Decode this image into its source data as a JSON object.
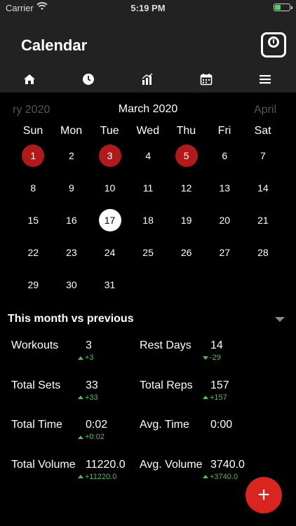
{
  "status_bar": {
    "carrier": "Carrier",
    "time": "5:19 PM",
    "battery_color": "#4cd964"
  },
  "header": {
    "title": "Calendar",
    "action_icon": "scale-icon"
  },
  "tabs": [
    {
      "icon": "home-icon"
    },
    {
      "icon": "clock-icon"
    },
    {
      "icon": "chart-icon"
    },
    {
      "icon": "calendar-icon"
    },
    {
      "icon": "menu-icon"
    }
  ],
  "calendar": {
    "prev_month": "ry 2020",
    "current_month": "March 2020",
    "next_month": "April",
    "weekdays": [
      "Sun",
      "Mon",
      "Tue",
      "Wed",
      "Thu",
      "Fri",
      "Sat"
    ],
    "days": [
      "1",
      "2",
      "3",
      "4",
      "5",
      "6",
      "7",
      "8",
      "9",
      "10",
      "11",
      "12",
      "13",
      "14",
      "15",
      "16",
      "17",
      "18",
      "19",
      "20",
      "21",
      "22",
      "23",
      "24",
      "25",
      "26",
      "27",
      "28",
      "29",
      "30",
      "31"
    ],
    "workout_days": [
      "1",
      "3",
      "5"
    ],
    "today": "17",
    "workout_color": "#b11a1a"
  },
  "comparison": {
    "title": "This month vs previous",
    "stats": [
      {
        "label": "Workouts",
        "value": "3",
        "delta": "+3",
        "direction": "up"
      },
      {
        "label": "Rest Days",
        "value": "14",
        "delta": "-29",
        "direction": "down"
      },
      {
        "label": "Total Sets",
        "value": "33",
        "delta": "+33",
        "direction": "up"
      },
      {
        "label": "Total Reps",
        "value": "157",
        "delta": "+157",
        "direction": "up"
      },
      {
        "label": "Total Time",
        "value": "0:02",
        "delta": "+0:02",
        "direction": "up"
      },
      {
        "label": "Avg. Time",
        "value": "0:00",
        "delta": "",
        "direction": ""
      },
      {
        "label": "Total Volume",
        "value": "11220.0",
        "delta": "+11220.0",
        "direction": "up"
      },
      {
        "label": "Avg. Volume",
        "value": "3740.0",
        "delta": "+3740.0",
        "direction": "up"
      }
    ],
    "delta_color": "#5cb85c"
  },
  "fab": {
    "label": "+",
    "color": "#d9251f"
  }
}
